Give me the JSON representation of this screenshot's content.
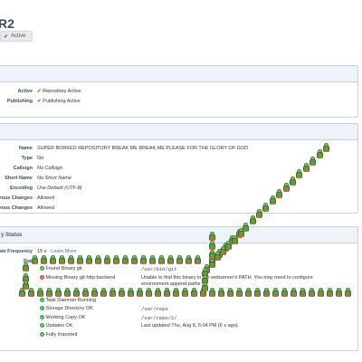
{
  "header": {
    "title": "R2",
    "status": "Active"
  },
  "panel1": {
    "rows": [
      {
        "label": "Active",
        "value": "Repository Active"
      },
      {
        "label": "Publishing",
        "value": "Publishing Active"
      }
    ]
  },
  "panel2": {
    "rows": [
      {
        "label": "Name",
        "value": "SUPER BORKED REPOSITORY BREAK ME BREAK ME PLEASE FOR THE GLORY OF GOD"
      },
      {
        "label": "Type",
        "value": "Git"
      },
      {
        "label": "Callsign",
        "value": "No Callsign"
      },
      {
        "label": "Short Name",
        "value": "No Short Name"
      },
      {
        "label": "Encoding",
        "value": "Use Default (UTF-8)"
      },
      {
        "label": "gerous Changes",
        "value": "Allowed"
      },
      {
        "label": "rous Changes",
        "value": "Allowed"
      }
    ]
  },
  "panel3": {
    "title": "y Status",
    "update_label": "date Frequency",
    "update_value": "15 s",
    "update_sep": " · ",
    "learn_more": "Learn More",
    "status_label": "Stat",
    "items": [
      {
        "name": "Found Binary git",
        "path": "/usr/bin/git",
        "state": "ok"
      },
      {
        "name": "Missing Binary git-http-backend",
        "path": "",
        "state": "error"
      },
      {
        "name": "Task Daemon Running",
        "path": "",
        "state": "ok"
      },
      {
        "name": "Storage Directory OK",
        "path": "/var/repo",
        "state": "ok"
      },
      {
        "name": "Working Copy OK",
        "path": "/var/repo/2/",
        "state": "ok"
      },
      {
        "name": "Updates OK",
        "path": "Last updated Thu, Aug 8, 6:04 PM (6 s ago).",
        "state": "ok"
      },
      {
        "name": "Fully Imported",
        "path": "",
        "state": "ok"
      }
    ],
    "error_message": "Unable to find this binary in the webserver's PATH. You may need to configure environment.append-paths."
  },
  "overlay": {
    "icon": "cactus-icon"
  }
}
